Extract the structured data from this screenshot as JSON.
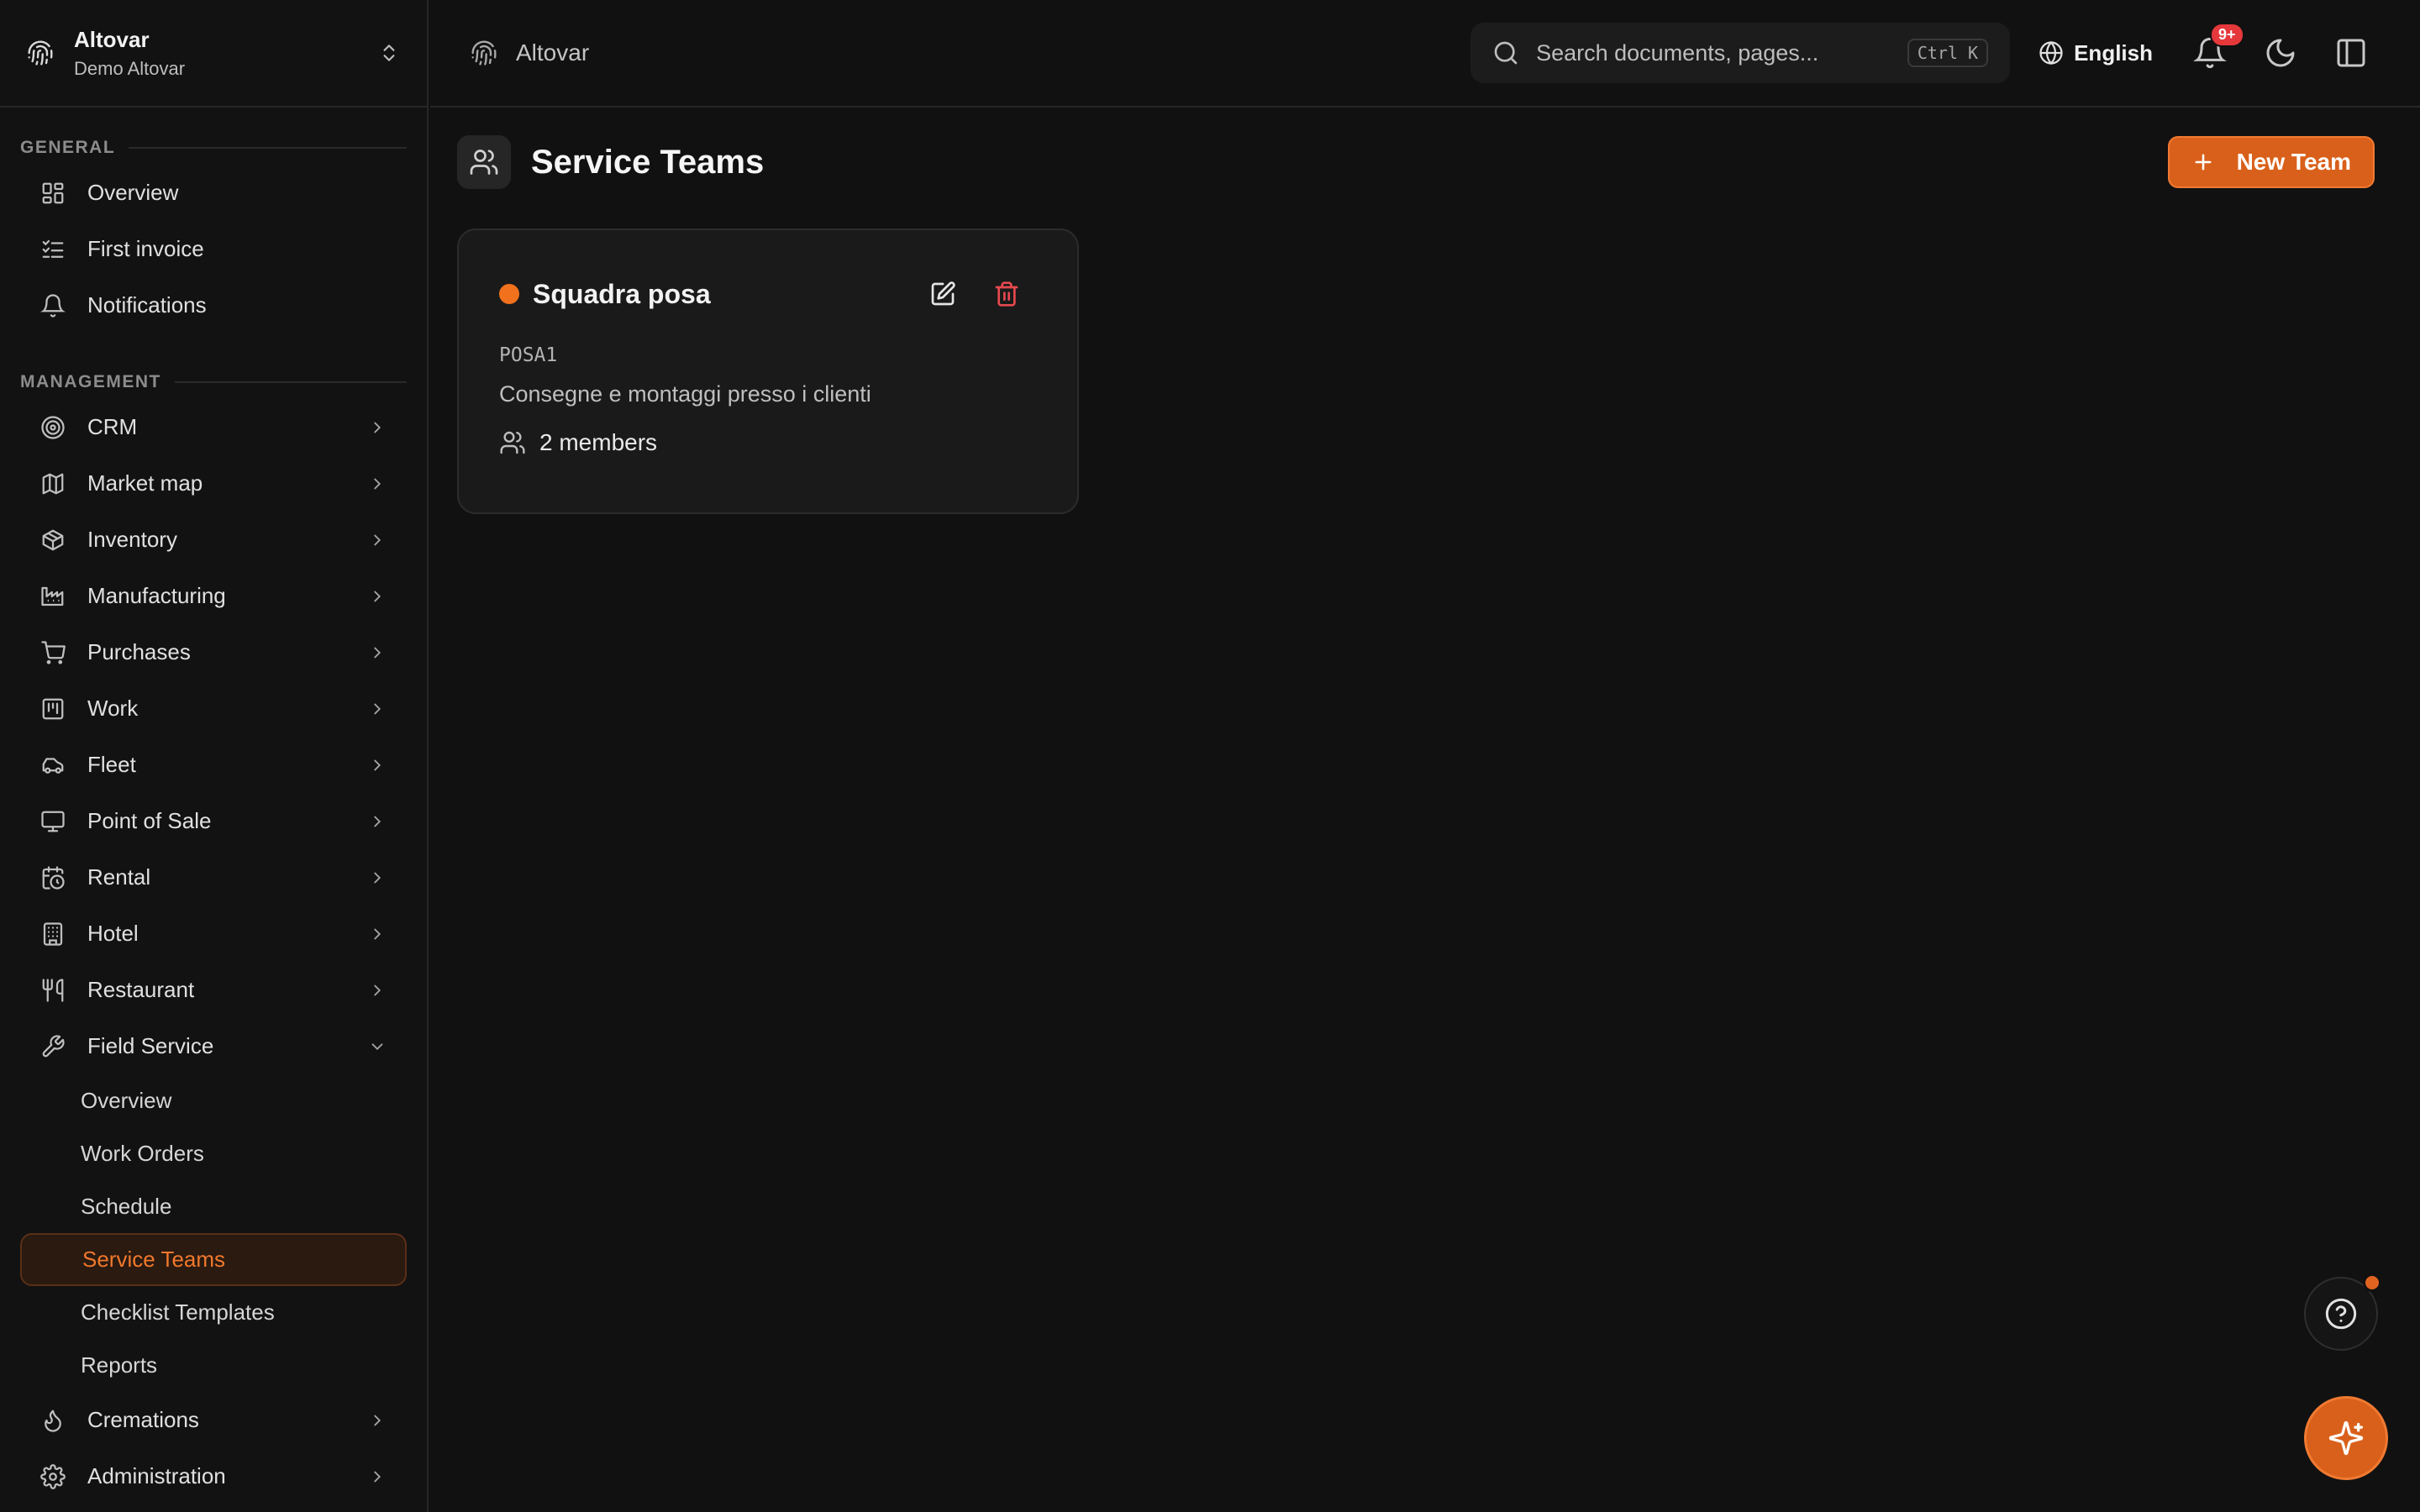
{
  "org": {
    "name": "Altovar",
    "subtitle": "Demo Altovar"
  },
  "sidebar": {
    "general_label": "GENERAL",
    "management_label": "MANAGEMENT",
    "general": [
      {
        "label": "Overview",
        "icon": "dashboard-icon"
      },
      {
        "label": "First invoice",
        "icon": "checklist-icon"
      },
      {
        "label": "Notifications",
        "icon": "bell-icon"
      }
    ],
    "management": [
      {
        "label": "CRM",
        "icon": "target-icon"
      },
      {
        "label": "Market map",
        "icon": "map-icon"
      },
      {
        "label": "Inventory",
        "icon": "package-icon"
      },
      {
        "label": "Manufacturing",
        "icon": "factory-icon"
      },
      {
        "label": "Purchases",
        "icon": "cart-icon"
      },
      {
        "label": "Work",
        "icon": "kanban-icon"
      },
      {
        "label": "Fleet",
        "icon": "car-icon"
      },
      {
        "label": "Point of Sale",
        "icon": "monitor-icon"
      },
      {
        "label": "Rental",
        "icon": "calendar-clock-icon"
      },
      {
        "label": "Hotel",
        "icon": "building-icon"
      },
      {
        "label": "Restaurant",
        "icon": "utensils-icon"
      },
      {
        "label": "Field Service",
        "icon": "wrench-icon"
      }
    ],
    "field_service_sub": [
      "Overview",
      "Work Orders",
      "Schedule",
      "Service Teams",
      "Checklist Templates",
      "Reports"
    ],
    "after": [
      {
        "label": "Cremations",
        "icon": "flame-icon"
      },
      {
        "label": "Administration",
        "icon": "gear-icon"
      }
    ]
  },
  "topbar": {
    "breadcrumb": "Altovar",
    "search_placeholder": "Search documents, pages...",
    "shortcut": "Ctrl K",
    "language": "English",
    "notification_badge": "9+"
  },
  "page": {
    "title": "Service Teams",
    "new_button": "New Team"
  },
  "teams": [
    {
      "name": "Squadra posa",
      "code": "POSA1",
      "description": "Consegne e montaggi presso i clienti",
      "members": "2 members",
      "color": "#f2711c"
    }
  ],
  "colors": {
    "accent": "#d9601a",
    "danger": "#e5484d",
    "background": "#111111"
  }
}
